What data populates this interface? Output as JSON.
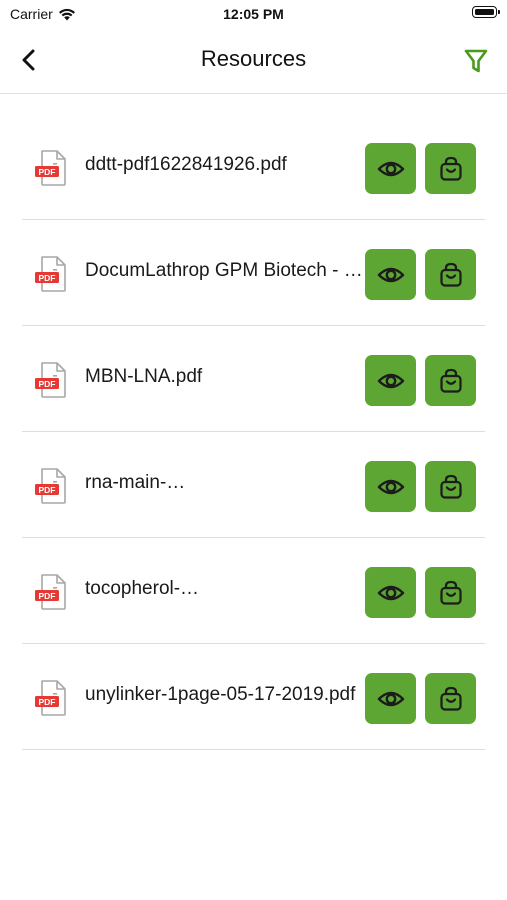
{
  "status_bar": {
    "carrier": "Carrier",
    "time": "12:05 PM"
  },
  "header": {
    "title": "Resources",
    "back_icon": "chevron-left-icon",
    "filter_icon": "filter-icon"
  },
  "colors": {
    "accent": "#5da633",
    "filter": "#4a9a1e",
    "pdf_red": "#e53935"
  },
  "resources": [
    {
      "name": "ddtt-pdf1622841926.pdf",
      "badge": "PDF"
    },
    {
      "name": "DocumLathrop GPM Biotech - Product & Services.pdf",
      "badge": "PDF"
    },
    {
      "name": "MBN-LNA.pdf",
      "badge": "PDF"
    },
    {
      "name": "rna-main-…",
      "badge": "PDF"
    },
    {
      "name": "tocopherol-…",
      "badge": "PDF"
    },
    {
      "name": "unylinker-1page-05-17-2019.pdf",
      "badge": "PDF"
    }
  ]
}
